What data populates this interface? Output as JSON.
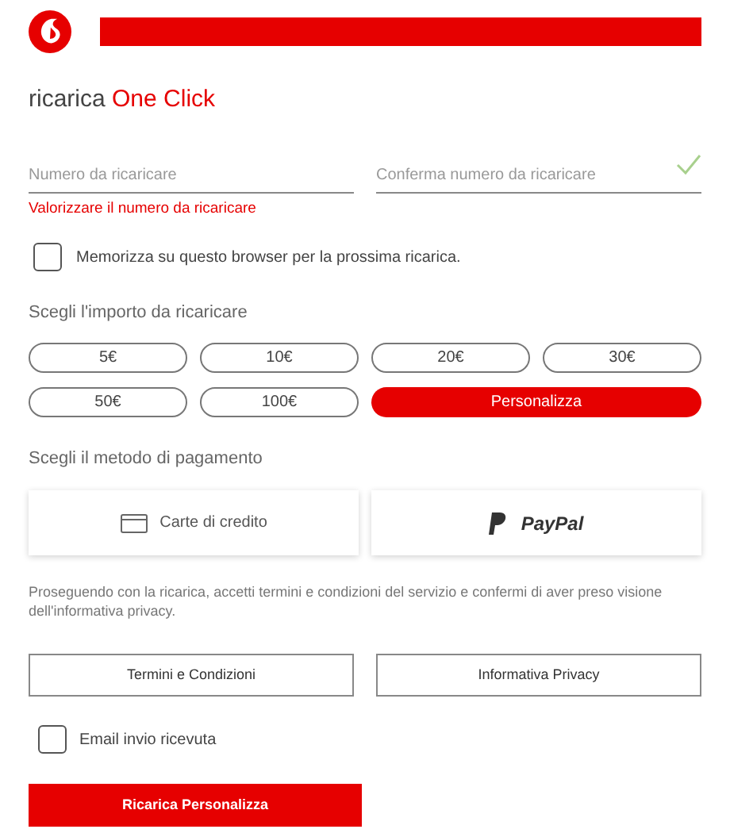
{
  "title": {
    "prefix": "ricarica",
    "highlight": "One Click"
  },
  "fields": [
    {
      "placeholder": "Numero da ricaricare",
      "valid": false,
      "error": "Valorizzare il numero da ricaricare"
    },
    {
      "placeholder": "Conferma numero da ricaricare",
      "valid": true
    }
  ],
  "remember": {
    "label": "Memorizza su questo browser per la prossima ricarica.",
    "checked": false
  },
  "amount_label": "Scegli l'importo da ricaricare",
  "amounts": [
    {
      "label": "5€",
      "selected": false
    },
    {
      "label": "10€",
      "selected": false
    },
    {
      "label": "20€",
      "selected": false
    },
    {
      "label": "30€",
      "selected": false
    },
    {
      "label": "50€",
      "selected": false
    },
    {
      "label": "100€",
      "selected": false
    },
    {
      "label": "Personalizza",
      "selected": true
    }
  ],
  "payment_label": "Scegli il metodo di pagamento",
  "payment_methods": [
    {
      "kind": "card",
      "label": "Carte di credito"
    },
    {
      "kind": "paypal",
      "label": "PayPal"
    }
  ],
  "notice": "Proseguendo con la ricarica, accetti termini e condizioni del servizio e confermi di aver preso visione dell'informativa privacy.",
  "links": [
    "Termini e Condizioni",
    "Informativa Privacy"
  ],
  "email_receipt": {
    "label": "Email invio ricevuta",
    "checked": false
  },
  "submit": "Ricarica Personalizza"
}
